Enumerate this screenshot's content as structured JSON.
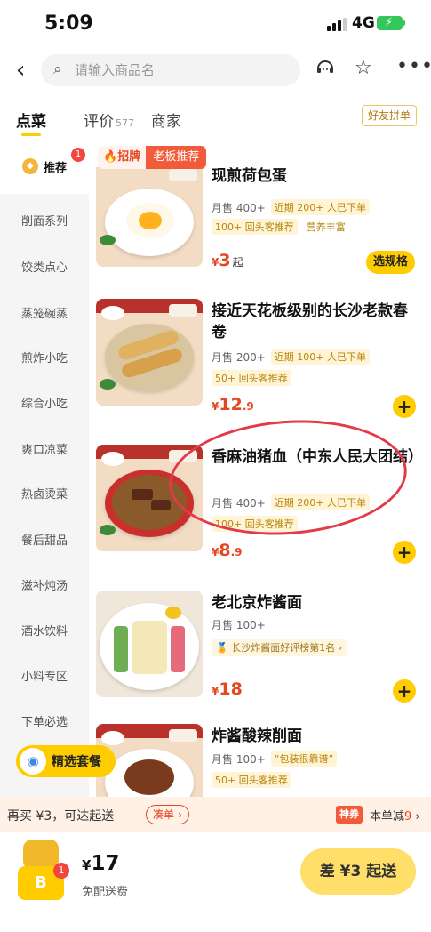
{
  "status": {
    "time": "5:09",
    "network": "4G",
    "battery_color": "#34c759"
  },
  "nav": {
    "search_placeholder": "请输入商品名"
  },
  "tabs": [
    {
      "label": "点菜",
      "active": true
    },
    {
      "label": "评价",
      "count": "577"
    },
    {
      "label": "商家"
    }
  ],
  "friend_group_btn": "好友拼单",
  "sidebar": {
    "badge": "1",
    "items": [
      "推荐",
      "削面系列",
      "饺类点心",
      "蒸笼碗蒸",
      "煎炸小吃",
      "综合小吃",
      "爽口凉菜",
      "热卤烫菜",
      "餐后甜品",
      "滋补炖汤",
      "酒水饮料",
      "小料专区",
      "下单必选"
    ]
  },
  "recruit": {
    "label1": "招牌",
    "label2": "老板推荐"
  },
  "items": [
    {
      "title": "现煎荷包蛋",
      "sales": "月售 400+",
      "tag1": "近期 200+ 人已下单",
      "tag2": "100+ 回头客推荐",
      "tag3": "营养丰富",
      "price_symbol": "¥",
      "price_int": "3",
      "price_qi": "起",
      "spec_button": "选规格"
    },
    {
      "title": "接近天花板级别的长沙老款春卷",
      "sales": "月售 200+",
      "tag1": "近期 100+ 人已下单",
      "tag2": "50+ 回头客推荐",
      "price_symbol": "¥",
      "price_int": "12",
      "price_dec": ".9"
    },
    {
      "title": "香麻油猪血（中东人民大团结）",
      "sales": "月售 400+",
      "tag1": "近期 200+ 人已下单",
      "tag2": "100+ 回头客推荐",
      "price_symbol": "¥",
      "price_int": "8",
      "price_dec": ".9"
    },
    {
      "title": "老北京炸酱面",
      "sales": "月售 100+",
      "rank": "长沙炸酱面好评榜第1名",
      "price_symbol": "¥",
      "price_int": "18"
    },
    {
      "title": "炸酱酸辣削面",
      "sales": "月售 100+",
      "tag1": "“包装很靠谱”",
      "tag2": "50+ 回头客推荐"
    }
  ],
  "combo": {
    "label": "精选套餐"
  },
  "promo": {
    "text": "再买 ¥3，可达起送",
    "gather": "凑单",
    "shen_label": "神券",
    "reduce_prefix": "本单减",
    "reduce_value": "9"
  },
  "bottom": {
    "cart_badge": "1",
    "total_symbol": "¥",
    "total_value": "17",
    "free_delivery": "免配送费",
    "diff_button": "差 ¥3 起送"
  },
  "accent_color": "#ffcc00",
  "price_color": "#e5451f"
}
